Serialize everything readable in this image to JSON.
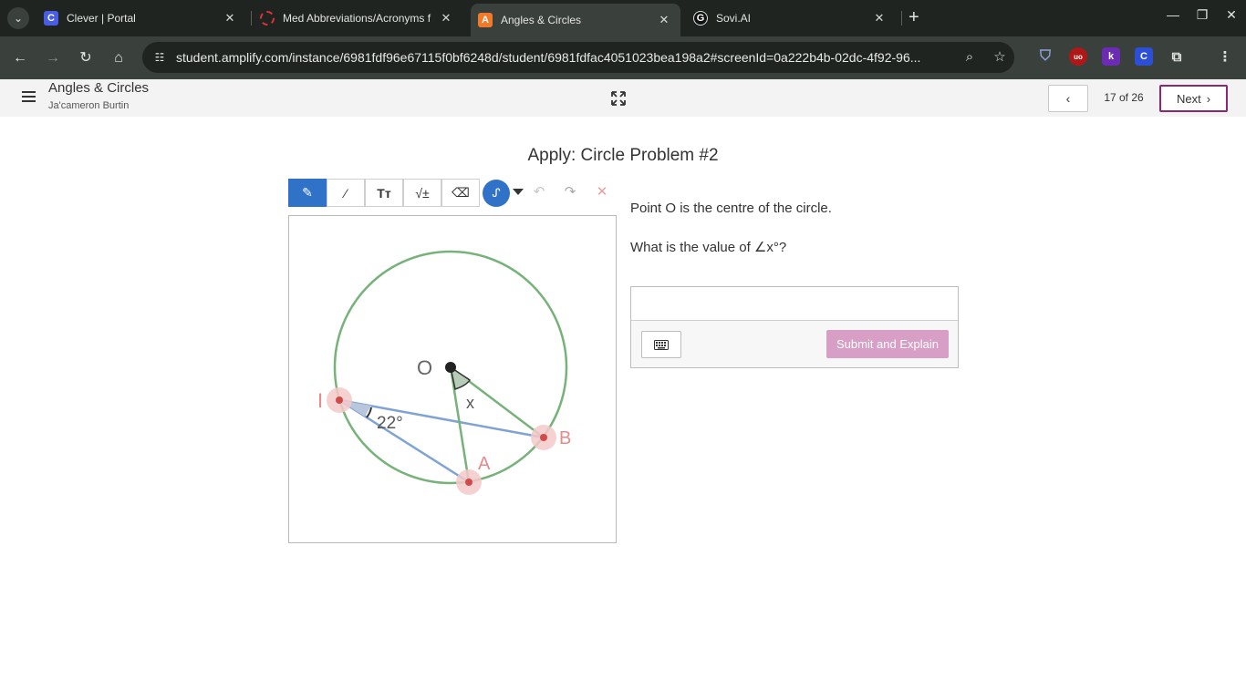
{
  "browser": {
    "tabs": [
      {
        "title": "Clever | Portal",
        "favicon": "C",
        "favicon_color": "#4a5ee5"
      },
      {
        "title": "Med Abbreviations/Acronyms f",
        "favicon": "",
        "favicon_color": "#e0303a"
      },
      {
        "title": "Angles & Circles",
        "favicon": "A",
        "favicon_color": "#f07a2a"
      },
      {
        "title": "Sovi.AI",
        "favicon": "G",
        "favicon_color": "#111111"
      }
    ],
    "url": "student.amplify.com/instance/6981fdf96e67115f0bf6248d/student/6981fdfac4051023bea198a2#screenId=0a222b4b-02dc-4f92-96...",
    "extensions": [
      {
        "label": "uo",
        "color": "#b01818"
      },
      {
        "label": "k",
        "color": "#6b2bb3"
      },
      {
        "label": "C",
        "color": "#2d4fd6"
      }
    ]
  },
  "app": {
    "title": "Angles & Circles",
    "user": "Ja'cameron Burtin",
    "page_count": "17 of 26",
    "next_label": "Next",
    "accent_color": "#8c2770"
  },
  "screen": {
    "title": "Apply: Circle Problem #2",
    "prompt_line1": "Point O is the centre of the circle.",
    "prompt_line2": "What is the value of ∠x°?",
    "submit_label": "Submit and Explain",
    "answer_value": ""
  },
  "figure": {
    "label_center": "O",
    "label_i": "I",
    "label_a": "A",
    "label_b": "B",
    "label_x": "x",
    "label_angle": "22°"
  },
  "tools": [
    "pen",
    "line",
    "text",
    "math",
    "eraser"
  ]
}
